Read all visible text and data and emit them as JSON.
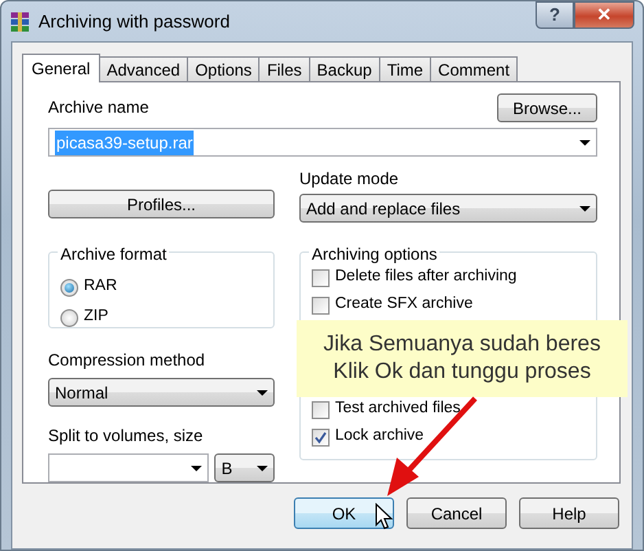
{
  "window": {
    "title": "Archiving with password",
    "title_buttons": [
      {
        "kind": "help",
        "label": "?"
      },
      {
        "kind": "close",
        "label": "✕"
      }
    ]
  },
  "tabs": [
    {
      "label": "General",
      "selected": true
    },
    {
      "label": "Advanced",
      "selected": false
    },
    {
      "label": "Options",
      "selected": false
    },
    {
      "label": "Files",
      "selected": false
    },
    {
      "label": "Backup",
      "selected": false
    },
    {
      "label": "Time",
      "selected": false
    },
    {
      "label": "Comment",
      "selected": false
    }
  ],
  "archive_name": {
    "label": "Archive name",
    "value": "picasa39-setup.rar",
    "browse_button": "Browse..."
  },
  "profiles_button": "Profiles...",
  "update_mode": {
    "label": "Update mode",
    "value": "Add and replace files"
  },
  "archive_format": {
    "label": "Archive format",
    "options": [
      {
        "label": "RAR",
        "selected": true
      },
      {
        "label": "ZIP",
        "selected": false
      }
    ]
  },
  "compression_method": {
    "label": "Compression method",
    "value": "Normal"
  },
  "split_volumes": {
    "label": "Split to volumes, size",
    "unit": "B"
  },
  "archiving_options": {
    "label": "Archiving options",
    "items": [
      {
        "label": "Delete files after archiving",
        "checked": false,
        "disabled": false
      },
      {
        "label": "Create SFX archive",
        "checked": false,
        "disabled": false
      },
      {
        "label": "Test archived files",
        "checked": false,
        "disabled": false
      },
      {
        "label": "Lock archive",
        "checked": true,
        "disabled": false
      }
    ]
  },
  "buttons": [
    {
      "label": "OK",
      "selected": true
    },
    {
      "label": "Cancel",
      "selected": false
    },
    {
      "label": "Help",
      "selected": false
    }
  ],
  "note": {
    "lines": [
      "Jika Semuanya sudah beres",
      "Klik Ok dan tunggu proses"
    ]
  }
}
